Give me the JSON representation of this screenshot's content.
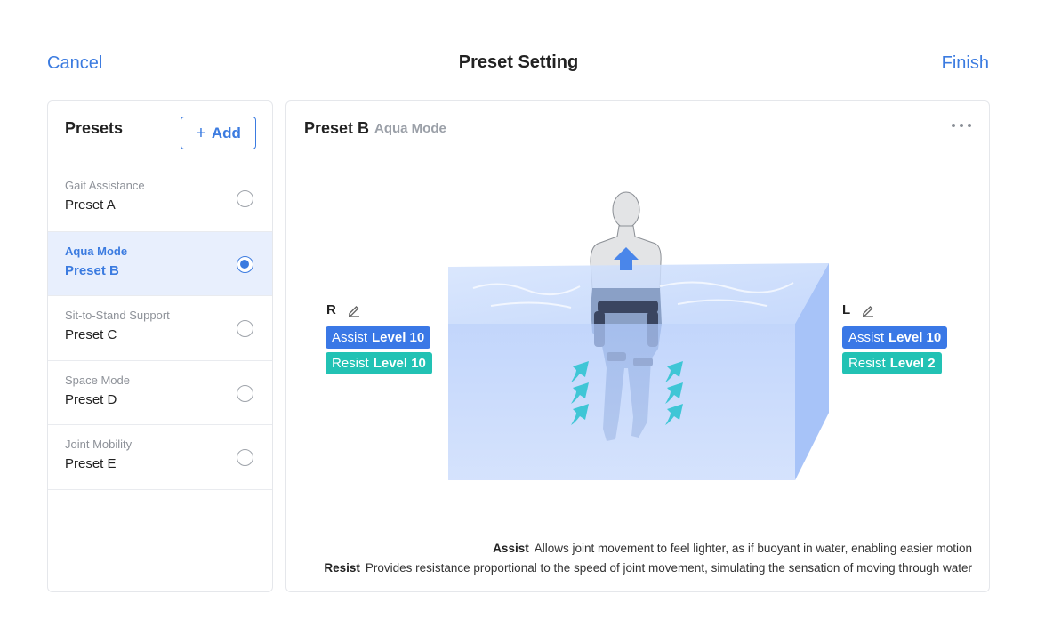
{
  "header": {
    "cancel_label": "Cancel",
    "title": "Preset Setting",
    "finish_label": "Finish"
  },
  "sidebar": {
    "title": "Presets",
    "add_label": "Add",
    "items": [
      {
        "category": "Gait Assistance",
        "name": "Preset A",
        "selected": false
      },
      {
        "category": "Aqua Mode",
        "name": "Preset B",
        "selected": true
      },
      {
        "category": "Sit-to-Stand Support",
        "name": "Preset C",
        "selected": false
      },
      {
        "category": "Space Mode",
        "name": "Preset D",
        "selected": false
      },
      {
        "category": "Joint Mobility",
        "name": "Preset E",
        "selected": false
      }
    ]
  },
  "main": {
    "preset_name": "Preset B",
    "preset_mode": "Aqua Mode",
    "right": {
      "side": "R",
      "assist_prefix": "Assist",
      "assist_value": "Level 10",
      "resist_prefix": "Resist",
      "resist_value": "Level 10"
    },
    "left": {
      "side": "L",
      "assist_prefix": "Assist",
      "assist_value": "Level 10",
      "resist_prefix": "Resist",
      "resist_value": "Level 2"
    },
    "legend": [
      {
        "term": "Assist",
        "text": "Allows joint movement to feel lighter, as if buoyant in water, enabling easier motion"
      },
      {
        "term": "Resist",
        "text": "Provides resistance proportional to the speed of joint movement, simulating the sensation of moving through water"
      }
    ]
  },
  "colors": {
    "accent": "#3b7be0",
    "assist_tag": "#3a78e6",
    "resist_tag": "#22c2b4",
    "selected_row": "#e8effd",
    "water": "#b9d0fb"
  },
  "icons": [
    "plus-icon",
    "radio-icon",
    "more-icon",
    "edit-icon",
    "up-arrow-icon",
    "wave-arrow-icon"
  ]
}
